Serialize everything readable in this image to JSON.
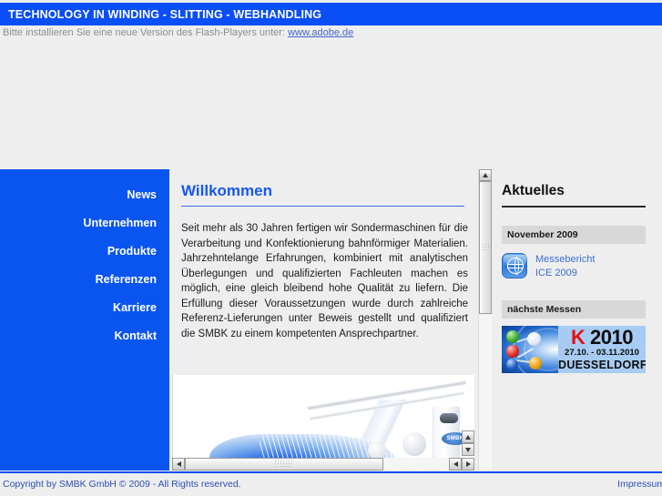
{
  "header": {
    "title": "TECHNOLOGY IN WINDING - SLITTING - WEBHANDLING",
    "flash_notice_prefix": "Bitte installieren Sie eine neue Version des Flash-Players unter: ",
    "flash_notice_link": "www.adobe.de"
  },
  "nav": {
    "items": [
      {
        "label": "News"
      },
      {
        "label": "Unternehmen"
      },
      {
        "label": "Produkte"
      },
      {
        "label": "Referenzen"
      },
      {
        "label": "Karriere"
      },
      {
        "label": "Kontakt"
      }
    ]
  },
  "main": {
    "title": "Willkommen",
    "body": "Seit mehr als 30 Jahren fertigen wir Sondermaschinen für die Verarbeitung und Konfektionierung bahnförmiger Materialien. Jahrzehntelange Erfahrungen, kombiniert mit analytischen Überlegungen und qualifizierten Fachleuten machen es möglich, eine gleich bleibend hohe Qualität zu liefern. Die Erfüllung dieser Voraussetzungen wurde durch zahlreiche Referenz-Lieferungen unter Beweis gestellt und qualifiziert die SMBK zu einem kompetenten Ansprechpartner.",
    "photo_logo": "SMBK"
  },
  "aside": {
    "title": "Aktuelles",
    "news_band": "November 2009",
    "news_item": {
      "icon": "globe-icon",
      "line1": "Messebericht",
      "line2": "ICE 2009"
    },
    "fairs_band": "nächste Messen",
    "fair_banner": {
      "letter": "K",
      "year": "2010",
      "dates": "27.10. - 03.11.2010",
      "city": "DUESSELDORF"
    }
  },
  "footer": {
    "copyright": "Copyright by SMBK GmbH © 2009 - All Rights reserved.",
    "impressum": "Impressum/"
  },
  "colors": {
    "brand_blue": "#0a4ef5",
    "nav_blue": "#0a55ef",
    "page_bg": "#eeeeee",
    "link_blue": "#3a6fd8",
    "k_red": "#e21313"
  }
}
